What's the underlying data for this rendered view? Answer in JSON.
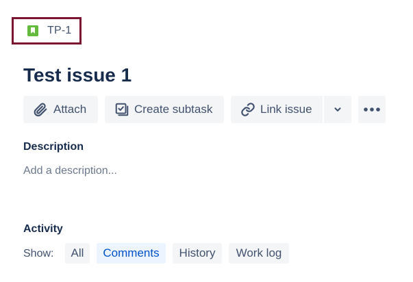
{
  "issue": {
    "key": "TP-1",
    "type_icon": "story-icon",
    "title": "Test issue 1"
  },
  "toolbar": {
    "attach_label": "Attach",
    "attach_icon": "paperclip-icon",
    "create_subtask_label": "Create subtask",
    "create_subtask_icon": "subtask-icon",
    "link_issue_label": "Link issue",
    "link_issue_icon": "link-icon",
    "link_dropdown_icon": "chevron-down-icon",
    "more_icon": "more-horizontal-icon"
  },
  "description": {
    "heading": "Description",
    "placeholder": "Add a description..."
  },
  "activity": {
    "heading": "Activity",
    "show_label": "Show:",
    "filters": [
      {
        "label": "All",
        "selected": false
      },
      {
        "label": "Comments",
        "selected": true
      },
      {
        "label": "History",
        "selected": false
      },
      {
        "label": "Work log",
        "selected": false
      }
    ]
  },
  "colors": {
    "highlight_border": "#7a1530",
    "story_icon": "#63ba3c",
    "selected_chip_bg": "#ebf4ff",
    "selected_chip_text": "#0052cc",
    "button_bg": "#f4f5f7",
    "title_text": "#172b4d"
  }
}
